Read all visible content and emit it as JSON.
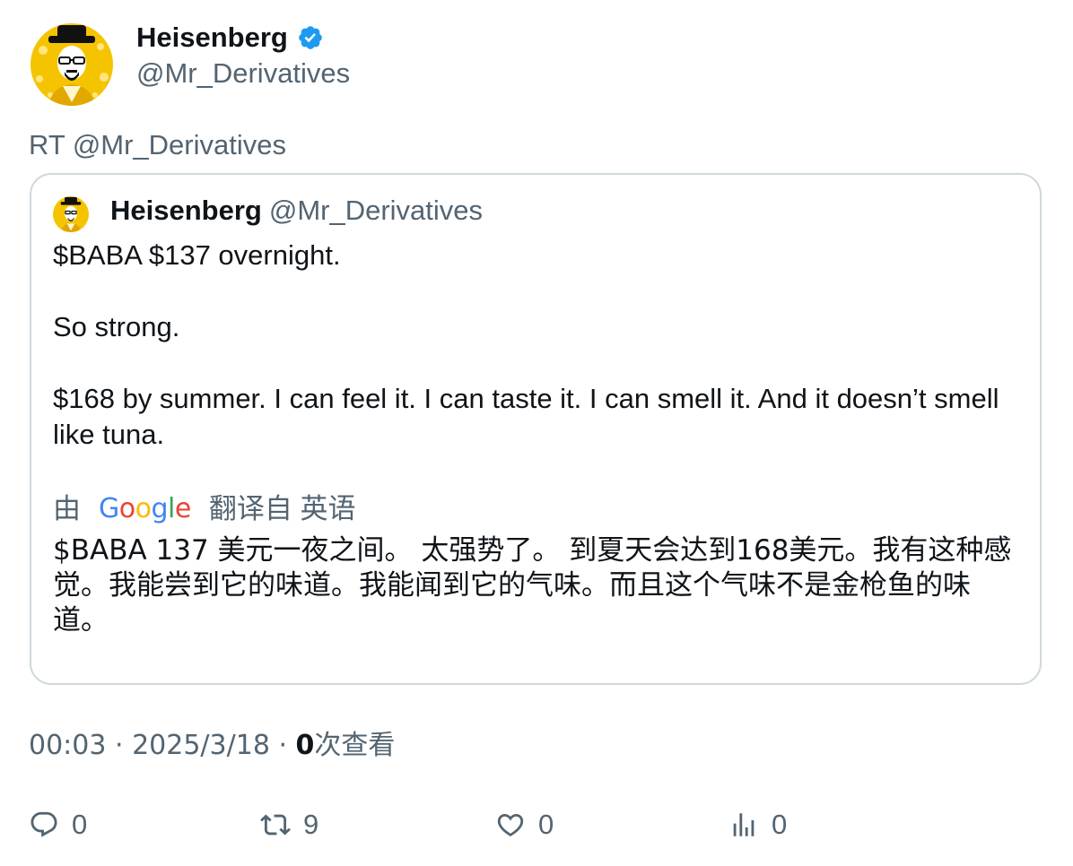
{
  "tweet": {
    "author": {
      "display_name": "Heisenberg",
      "handle": "@Mr_Derivatives",
      "verified": true
    },
    "retweet_line": "RT @Mr_Derivatives",
    "quoted": {
      "display_name": "Heisenberg",
      "handle": "@Mr_Derivatives",
      "text_lines": [
        "$BABA $137 overnight.",
        "So strong.",
        "$168 by summer. I can feel it. I can taste it. I can smell it. And it doesn’t smell like tuna."
      ],
      "translation": {
        "prefix": "由",
        "provider": "Google",
        "suffix": "翻译自 英语",
        "text": "$BABA 137 美元一夜之间。 太强势了。 到夏天会达到168美元。我有这种感觉。我能尝到它的味道。我能闻到它的气味。而且这个气味不是金枪鱼的味道。"
      }
    },
    "meta": {
      "time": "00:03",
      "separator": " · ",
      "date": "2025/3/18",
      "views_count": "0",
      "views_label": "次查看"
    },
    "actions": {
      "replies": "0",
      "retweets": "9",
      "likes": "0",
      "views": "0"
    }
  },
  "colors": {
    "secondary_text": "#536471",
    "primary_text": "#0f1419",
    "verified_blue": "#1d9bf0",
    "border": "#cfd9de",
    "avatar_yellow": "#f5c400"
  },
  "icons": {
    "verified": "verified-badge-icon",
    "reply": "reply-icon",
    "retweet": "retweet-icon",
    "like": "heart-icon",
    "views": "analytics-icon"
  }
}
